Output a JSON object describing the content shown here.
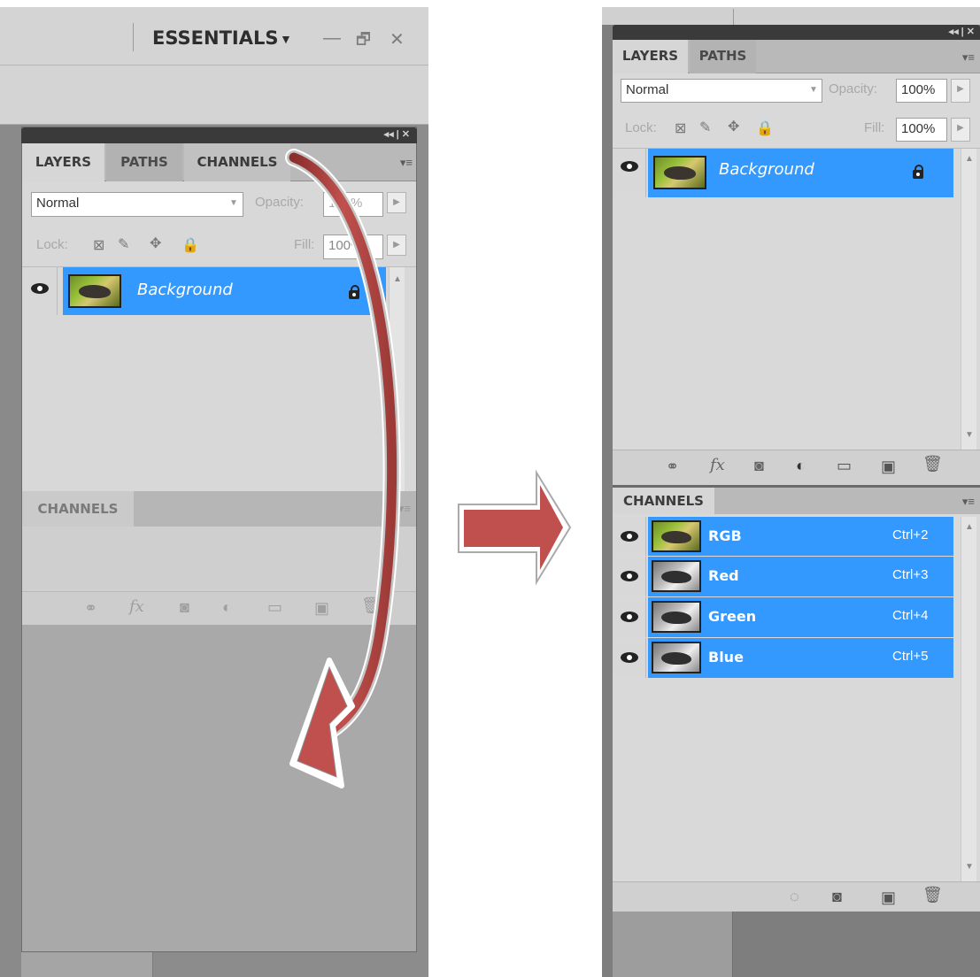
{
  "left": {
    "workspace_label": "ESSENTIALS",
    "workspace_arrow": "▼",
    "window_controls": [
      "—",
      "🗗",
      "✕"
    ],
    "panel_header_controls": "◂◂ | ✕",
    "tabs": [
      "LAYERS",
      "PATHS",
      "CHANNELS"
    ],
    "panel_menu": "▾≡",
    "blend_mode": "Normal",
    "opacity_label": "Opacity:",
    "opacity_value": "100%",
    "lock_label": "Lock:",
    "fill_label": "Fill:",
    "fill_value": "100%",
    "layer_name": "Background",
    "lower_tab": "CHANNELS",
    "footer_icons": [
      "link-icon",
      "fx-icon",
      "mask-icon",
      "adjustment-icon",
      "folder-icon",
      "new-layer-icon",
      "trash-icon"
    ]
  },
  "right": {
    "panel_header_controls": "◂◂ | ✕",
    "tabs": [
      "LAYERS",
      "PATHS"
    ],
    "panel_menu": "▾≡",
    "blend_mode": "Normal",
    "opacity_label": "Opacity:",
    "opacity_value": "100%",
    "lock_label": "Lock:",
    "fill_label": "Fill:",
    "fill_value": "100%",
    "layer_name": "Background",
    "channels_tab": "CHANNELS",
    "channels": [
      {
        "name": "RGB",
        "shortcut": "Ctrl+2"
      },
      {
        "name": "Red",
        "shortcut": "Ctrl+3"
      },
      {
        "name": "Green",
        "shortcut": "Ctrl+4"
      },
      {
        "name": "Blue",
        "shortcut": "Ctrl+5"
      }
    ]
  },
  "colors": {
    "selection": "#3399ff",
    "arrow": "#c0504d"
  }
}
